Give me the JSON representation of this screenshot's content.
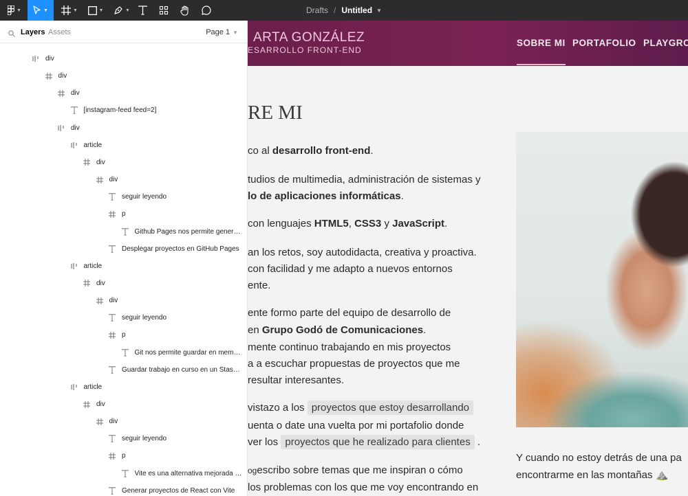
{
  "toolbar": {
    "breadcrumb_parent": "Drafts",
    "separator": "/",
    "file_name": "Untitled",
    "accent": "#1e90ff"
  },
  "panel": {
    "tab_layers": "Layers",
    "tab_assets": "Assets",
    "page_selector": "Page 1",
    "layers": [
      {
        "name": "div",
        "icon": "auto-layout-icon",
        "depth": 1
      },
      {
        "name": "div",
        "icon": "frame-icon",
        "depth": 2
      },
      {
        "name": "div",
        "icon": "frame-icon",
        "depth": 3
      },
      {
        "name": "[instagram-feed feed=2]",
        "icon": "text-icon",
        "depth": 4
      },
      {
        "name": "div",
        "icon": "auto-layout-icon",
        "depth": 3
      },
      {
        "name": "article",
        "icon": "auto-layout-icon",
        "depth": 4
      },
      {
        "name": "div",
        "icon": "frame-icon",
        "depth": 5
      },
      {
        "name": "div",
        "icon": "frame-icon",
        "depth": 6
      },
      {
        "name": "seguir leyendo",
        "icon": "text-icon",
        "depth": 7
      },
      {
        "name": "p",
        "icon": "frame-icon",
        "depth": 7
      },
      {
        "name": "Github Pages nos permite generar ...",
        "icon": "text-icon",
        "depth": 8
      },
      {
        "name": "Desplegar proyectos en GitHub Pages",
        "icon": "text-icon",
        "depth": 7
      },
      {
        "name": "article",
        "icon": "auto-layout-icon",
        "depth": 4
      },
      {
        "name": "div",
        "icon": "frame-icon",
        "depth": 5
      },
      {
        "name": "div",
        "icon": "frame-icon",
        "depth": 6
      },
      {
        "name": "seguir leyendo",
        "icon": "text-icon",
        "depth": 7
      },
      {
        "name": "p",
        "icon": "frame-icon",
        "depth": 7
      },
      {
        "name": "Git nos permite guardar en memori...",
        "icon": "text-icon",
        "depth": 8
      },
      {
        "name": "Guardar trabajo en curso en un Stash c...",
        "icon": "text-icon",
        "depth": 7
      },
      {
        "name": "article",
        "icon": "auto-layout-icon",
        "depth": 4
      },
      {
        "name": "div",
        "icon": "frame-icon",
        "depth": 5
      },
      {
        "name": "div",
        "icon": "frame-icon",
        "depth": 6
      },
      {
        "name": "seguir leyendo",
        "icon": "text-icon",
        "depth": 7
      },
      {
        "name": "p",
        "icon": "frame-icon",
        "depth": 7
      },
      {
        "name": "Vite es una alternativa mejorada a l...",
        "icon": "text-icon",
        "depth": 8
      },
      {
        "name": "Generar proyectos de React con Vite",
        "icon": "text-icon",
        "depth": 7
      }
    ]
  },
  "site": {
    "brand_name": "ARTA GONZÁLEZ",
    "brand_sub": "ESARROLLO FRONT-END",
    "nav": [
      "SOBRE MI",
      "PORTAFOLIO",
      "PLAYGROU"
    ],
    "heading": "RE MI",
    "p1_a": "co al ",
    "p1_b": "desarrollo front-end",
    "p1_c": ".",
    "p2_l1": "tudios de multimedia, administración de sistemas y",
    "p2_l2": "lo de aplicaciones informáticas",
    "p2_l2_end": ".",
    "p3_a": "con lenguajes ",
    "p3_b": "HTML5",
    "p3_c": ", ",
    "p3_d": "CSS3",
    "p3_e": " y ",
    "p3_f": "JavaScript",
    "p3_g": ".",
    "p4_l1": "an los retos, soy autodidacta, creativa y proactiva.",
    "p4_l2": " con facilidad y me adapto a nuevos entornos",
    "p4_l3": "ente.",
    "p5_l1": "ente formo parte del equipo de desarrollo de",
    "p5_l2_a": " en ",
    "p5_l2_b": "Grupo Godó de Comunicaciones",
    "p5_l2_c": ".",
    "p5_l3": "mente continuo trabajando en mis proyectos",
    "p5_l4": "a a escuchar propuestas de proyectos que me",
    "p5_l5": "resultar interesantes.",
    "p6_l1_a": "vistazo a los ",
    "p6_l1_chip": "proyectos que estoy desarrollando",
    "p6_l2": "uenta o date una vuelta por mi portafolio donde",
    "p6_l3_a": "ver los ",
    "p6_l3_chip": "proyectos que he realizado para clientes",
    "p6_l3_b": " .",
    "p7_l1_a": "og",
    "p7_l1_b": "escribo sobre temas que me inspiran o cómo",
    "p7_l2": " los problemas con los que me voy encontrando en",
    "caption_l1": "Y cuando no estoy detrás de una pa",
    "caption_l2": "encontrarme en las montañas ⛰️"
  }
}
